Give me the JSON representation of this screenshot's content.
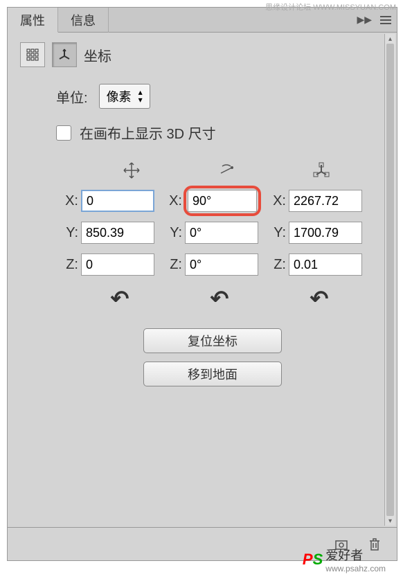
{
  "watermark": {
    "top": "思缘设计论坛 WWW.MISSYUAN.COM",
    "bottom_text": "爱好者",
    "bottom_url": "www.psahz.com"
  },
  "tabs": {
    "properties": "属性",
    "info": "信息"
  },
  "section_title": "坐标",
  "unit": {
    "label": "单位:",
    "value": "像素"
  },
  "checkbox": {
    "label": "在画布上显示 3D 尺寸"
  },
  "coords": {
    "position": {
      "x_label": "X:",
      "x_value": "0",
      "y_label": "Y:",
      "y_value": "850.39",
      "z_label": "Z:",
      "z_value": "0"
    },
    "rotation": {
      "x_label": "X:",
      "x_value": "90°",
      "y_label": "Y:",
      "y_value": "0°",
      "z_label": "Z:",
      "z_value": "0°"
    },
    "scale": {
      "x_label": "X:",
      "x_value": "2267.72",
      "y_label": "Y:",
      "y_value": "1700.79",
      "z_label": "Z:",
      "z_value": "0.01"
    }
  },
  "buttons": {
    "reset_coords": "复位坐标",
    "move_to_ground": "移到地面"
  }
}
